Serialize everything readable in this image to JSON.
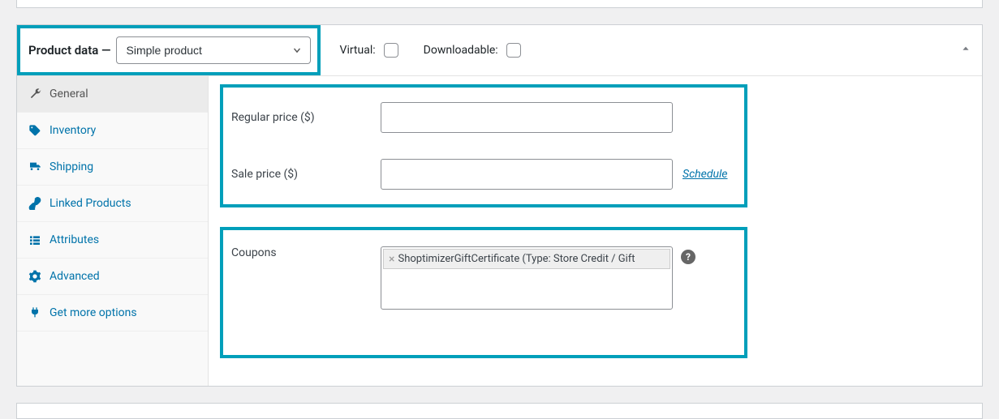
{
  "header": {
    "title_prefix": "Product data —",
    "product_type": "Simple product",
    "virtual_label": "Virtual:",
    "downloadable_label": "Downloadable:"
  },
  "tabs": {
    "general": "General",
    "inventory": "Inventory",
    "shipping": "Shipping",
    "linked": "Linked Products",
    "attributes": "Attributes",
    "advanced": "Advanced",
    "get_more": "Get more options"
  },
  "fields": {
    "regular_price_label": "Regular price ($)",
    "regular_price_value": "",
    "sale_price_label": "Sale price ($)",
    "sale_price_value": "",
    "schedule_label": "Schedule",
    "coupons_label": "Coupons",
    "coupon_token": "ShoptimizerGiftCertificate (Type: Store Credit / Gift",
    "help_char": "?"
  },
  "icons": {
    "token_remove": "×"
  }
}
